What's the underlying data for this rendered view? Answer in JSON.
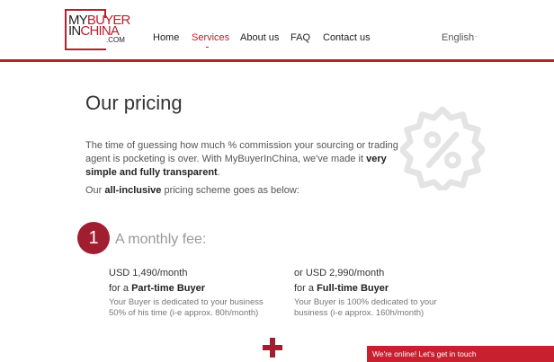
{
  "logo": {
    "line1_dark": "MY",
    "line1_red": "BUYER",
    "line2_dark": "IN",
    "line2_red": "CHINA",
    "line3": ".COM"
  },
  "nav": {
    "home": "Home",
    "services": "Services",
    "about": "About us",
    "faq": "FAQ",
    "contact": "Contact us"
  },
  "language": {
    "selected": "English",
    "arrow": "-"
  },
  "page": {
    "title": "Our pricing"
  },
  "intro": {
    "p1_text": "The time of guessing how much % commission your sourcing or trading agent is pocketing is over. With MyBuyerInChina, we've made it ",
    "p1_bold": "very simple and fully transparent",
    "p1_end": ".",
    "p2_start": "Our ",
    "p2_bold": "all-inclusive",
    "p2_end": " pricing scheme goes as below:"
  },
  "step1": {
    "number": "1",
    "label": "A monthly fee:"
  },
  "plans": [
    {
      "prefix": "",
      "price": "USD 1,490",
      "period": "/month",
      "for_text": "for a ",
      "name": "Part-time Buyer",
      "desc1": "Your Buyer is dedicated to your business",
      "desc2": "50% of his time (i-e approx. 80h/month)"
    },
    {
      "prefix": "or ",
      "price": "USD 2,990",
      "period": "/month",
      "for_text": "for a ",
      "name": "Full-time Buyer",
      "desc1": "Your Buyer is 100% dedicated to your",
      "desc2": "business (i-e approx. 160h/month)"
    }
  ],
  "chat": {
    "label": "We're online! Let's get in touch"
  },
  "icons": {
    "badge": "percent-badge-icon",
    "plus": "plus-icon"
  },
  "colors": {
    "brand": "#b8202f",
    "step": "#a01e2f",
    "badge": "#e4e4e4"
  }
}
